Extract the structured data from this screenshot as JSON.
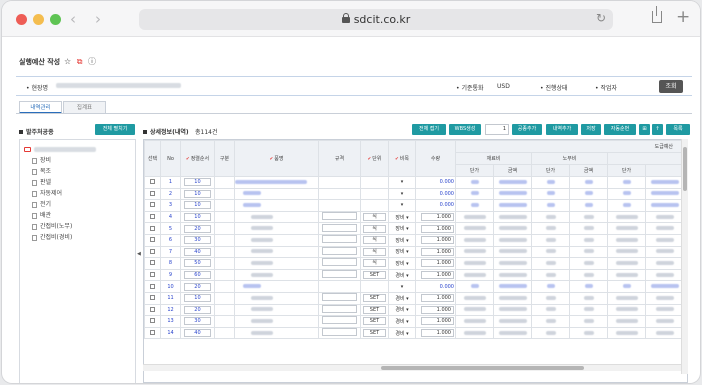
{
  "browser": {
    "url": "sdcit.co.kr"
  },
  "page": {
    "title": "실행예산 작성"
  },
  "filter": {
    "site_label": "• 현장명",
    "base_currency_label": "• 기준통화",
    "base_currency_value": "USD",
    "status_label": "• 진행상태",
    "author_label": "• 작업자",
    "search_button": "조회"
  },
  "tabs": [
    {
      "label": "내역관리",
      "active": true
    },
    {
      "label": "집계표",
      "active": false
    }
  ],
  "left_panel": {
    "title": "발주처공종",
    "expand_all": "전체 펼치기",
    "tree_items": [
      "장비",
      "목조",
      "판넬",
      "자동제어",
      "전기",
      "배관",
      "간접비(노무)",
      "간접비(경비)"
    ]
  },
  "right_panel": {
    "title": "상세정보(내역)",
    "total_label": "총114건",
    "buttons": [
      "전체 접기",
      "WBS생성",
      "공종추가",
      "내역추가",
      "저장",
      "자동순번",
      "목록"
    ],
    "page_value": "1"
  },
  "grid": {
    "headers": {
      "select": "선택",
      "no": "No",
      "sort_order": "정렬순서",
      "division": "구분",
      "item": "품명",
      "spec": "규격",
      "unit": "단위",
      "cost_type": "비목",
      "quantity": "수량",
      "contract_group": "도급예산",
      "material": "재료비",
      "labor": "노무비",
      "unit_price": "단가",
      "amount": "금액"
    },
    "rows": [
      {
        "no": "1",
        "sort": "10",
        "unit": "",
        "type": "",
        "qty": "0.000",
        "level": "group"
      },
      {
        "no": "2",
        "sort": "10",
        "unit": "",
        "type": "",
        "qty": "0.000",
        "level": "group"
      },
      {
        "no": "3",
        "sort": "10",
        "unit": "",
        "type": "",
        "qty": "0.000",
        "level": "group"
      },
      {
        "no": "4",
        "sort": "10",
        "unit": "식",
        "type": "장비",
        "qty": "1.000",
        "level": "item"
      },
      {
        "no": "5",
        "sort": "20",
        "unit": "식",
        "type": "장비",
        "qty": "1.000",
        "level": "item"
      },
      {
        "no": "6",
        "sort": "30",
        "unit": "식",
        "type": "장비",
        "qty": "1.000",
        "level": "item"
      },
      {
        "no": "7",
        "sort": "40",
        "unit": "식",
        "type": "장비",
        "qty": "1.000",
        "level": "item"
      },
      {
        "no": "8",
        "sort": "50",
        "unit": "식",
        "type": "장비",
        "qty": "1.000",
        "level": "item"
      },
      {
        "no": "9",
        "sort": "60",
        "unit": "SET",
        "type": "경비",
        "qty": "1.000",
        "level": "item"
      },
      {
        "no": "10",
        "sort": "20",
        "unit": "",
        "type": "",
        "qty": "0.000",
        "level": "group"
      },
      {
        "no": "11",
        "sort": "10",
        "unit": "SET",
        "type": "경비",
        "qty": "1.000",
        "level": "item"
      },
      {
        "no": "12",
        "sort": "20",
        "unit": "SET",
        "type": "경비",
        "qty": "1.000",
        "level": "item"
      },
      {
        "no": "13",
        "sort": "30",
        "unit": "SET",
        "type": "경비",
        "qty": "1.000",
        "level": "item"
      },
      {
        "no": "14",
        "sort": "40",
        "unit": "SET",
        "type": "경비",
        "qty": "1.000",
        "level": "item"
      }
    ]
  }
}
